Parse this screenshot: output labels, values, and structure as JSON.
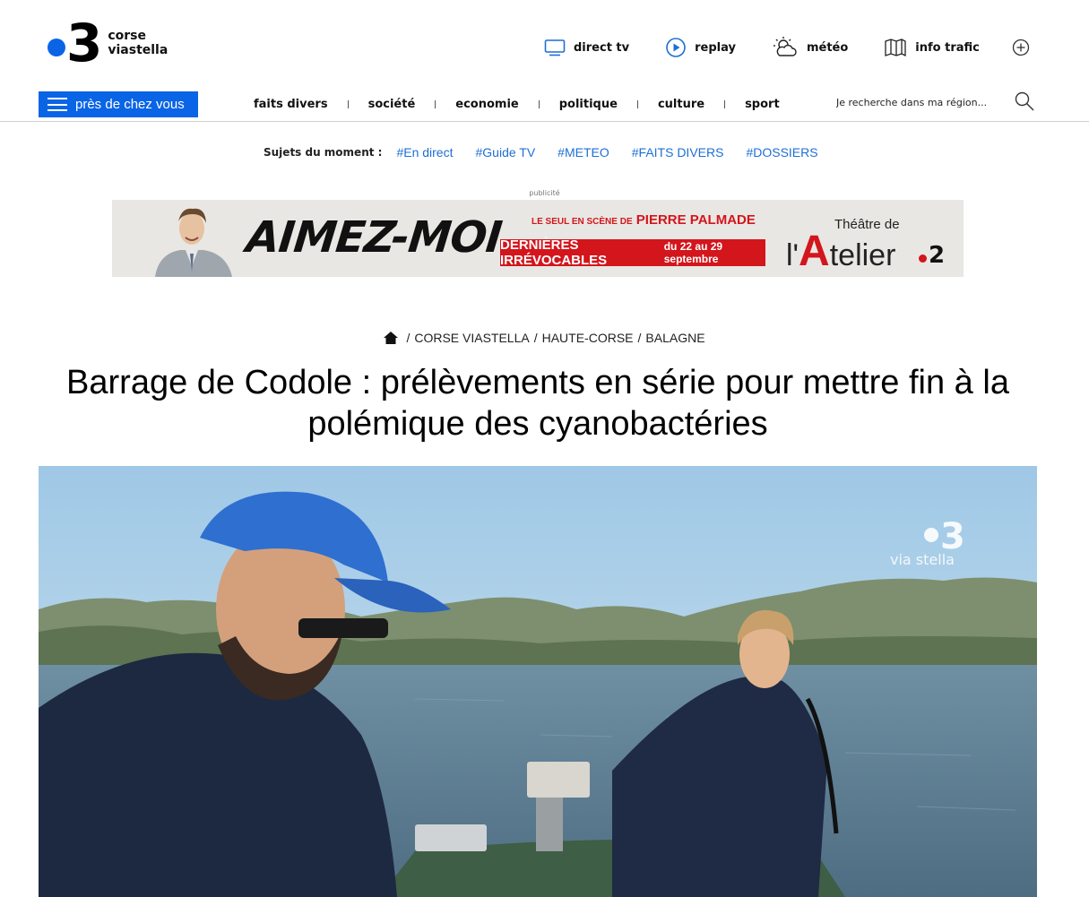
{
  "brand": {
    "logo_number": "3",
    "name_line1": "corse",
    "name_line2": "viastella",
    "accent": "#0a64e6"
  },
  "topnav": {
    "items": [
      {
        "label": "direct tv",
        "icon": "tv-icon"
      },
      {
        "label": "replay",
        "icon": "play-icon"
      },
      {
        "label": "météo",
        "icon": "weather-icon"
      },
      {
        "label": "info trafic",
        "icon": "map-icon"
      }
    ],
    "more_icon": "plus-circle-icon"
  },
  "menu_button": {
    "label": "près de chez vous",
    "icon": "hamburger-icon"
  },
  "mainnav": {
    "items": [
      "faits divers",
      "société",
      "economie",
      "politique",
      "culture",
      "sport"
    ]
  },
  "search": {
    "placeholder": "Je recherche dans ma région..."
  },
  "sujets": {
    "label": "Sujets du moment :",
    "tags": [
      "#En direct",
      "#Guide TV",
      "#METEO",
      "#FAITS DIVERS",
      "#DOSSIERS"
    ],
    "link_color": "#1e6fd4"
  },
  "ad": {
    "label": "publicité",
    "headline": "AIMEZ-MOI",
    "tagline_small": "LE SEUL EN SCÈNE DE",
    "tagline_name": "PIERRE PALMADE",
    "dates_a": "DERNIÈRES IRRÉVOCABLES",
    "dates_b": "du 22 au 29 septembre",
    "theatre_small": "Théâtre de",
    "theatre_l": "l'",
    "theatre_a": "A",
    "theatre_rest": "telier",
    "channel": "2",
    "accent": "#d3151c"
  },
  "breadcrumb": {
    "home_icon": "home-icon",
    "items": [
      "CORSE VIASTELLA",
      "HAUTE-CORSE",
      "BALAGNE"
    ]
  },
  "article": {
    "title": "Barrage de Codole : prélèvements en série pour mettre fin à la polémique des cyanobactéries"
  },
  "photo": {
    "watermark_number": "3",
    "watermark_text": "via stella"
  }
}
